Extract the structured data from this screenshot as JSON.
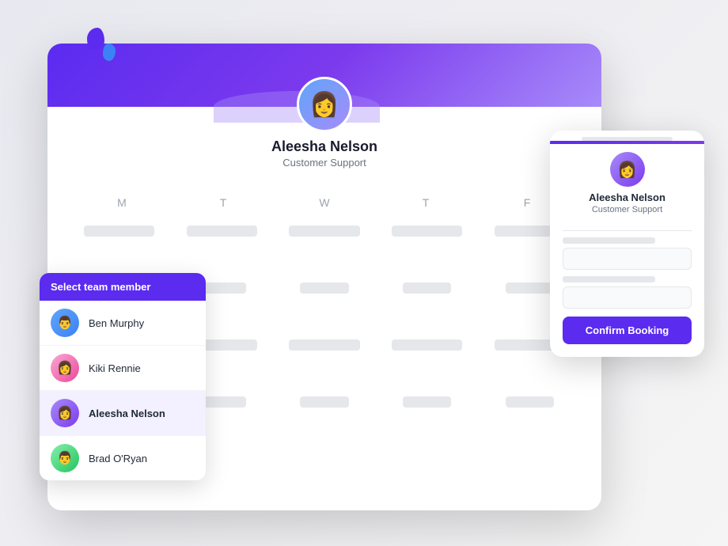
{
  "scene": {
    "blobs": [
      "purple",
      "blue"
    ]
  },
  "calendar": {
    "days": [
      "M",
      "T",
      "W",
      "T",
      "F"
    ],
    "rows": 4,
    "cols": 5
  },
  "profile": {
    "name": "Aleesha Nelson",
    "role": "Customer Support",
    "avatar_emoji": "👩"
  },
  "dropdown": {
    "header": "Select team member",
    "members": [
      {
        "id": "ben",
        "name": "Ben Murphy",
        "avatar_class": "ben",
        "emoji": "👨",
        "selected": false
      },
      {
        "id": "kiki",
        "name": "Kiki Rennie",
        "avatar_class": "kiki",
        "emoji": "👩",
        "selected": false
      },
      {
        "id": "aleesha",
        "name": "Aleesha Nelson",
        "avatar_class": "aleesha",
        "emoji": "👩",
        "selected": true
      },
      {
        "id": "brad",
        "name": "Brad O'Ryan",
        "avatar_class": "brad",
        "emoji": "👨",
        "selected": false
      }
    ]
  },
  "mobile_card": {
    "name": "Aleesha Nelson",
    "role": "Customer Support",
    "avatar_emoji": "👩",
    "confirm_button_label": "Confirm Booking"
  }
}
